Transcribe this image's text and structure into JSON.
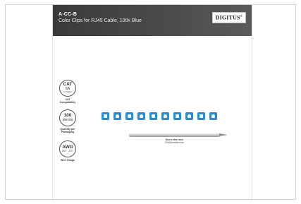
{
  "header": {
    "sku": "A-CC-B",
    "title": "Color Clips for RJ45 Cable, 100x Blue",
    "logo": "DIGITUS",
    "logo_mark": "®"
  },
  "features": [
    {
      "badge_main": "CAT",
      "badge_sub": "6A",
      "badge_note": "or higher",
      "caption": "CAT Compatibility"
    },
    {
      "badge_main": "100",
      "badge_sub": "pieces",
      "badge_note": "",
      "caption": "Quantity per Packaging"
    },
    {
      "badge_main": "AWG",
      "badge_sub": "24/7 - 27/7",
      "badge_note": "",
      "caption": "Wire Gauge"
    }
  ],
  "reference": {
    "label": "Size reference",
    "sublabel": "Größenreferenz"
  },
  "colors": {
    "header_bg": "#444444",
    "clip": "#1f8fe0"
  },
  "clips_count": 10
}
